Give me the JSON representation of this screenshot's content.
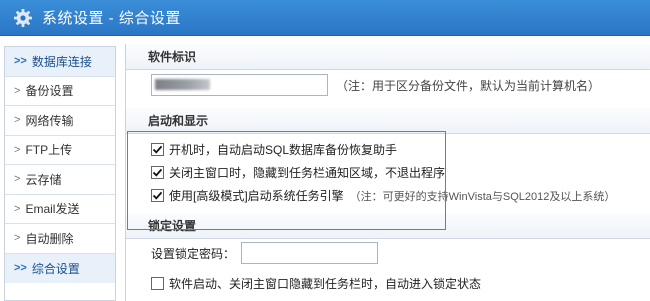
{
  "window": {
    "title": "系统设置 - 综合设置"
  },
  "sidebar": {
    "items": [
      {
        "label": "数据库连接",
        "marker": ">>",
        "active": true
      },
      {
        "label": "备份设置",
        "marker": ">",
        "active": false
      },
      {
        "label": "网络传输",
        "marker": ">",
        "active": false
      },
      {
        "label": "FTP上传",
        "marker": ">",
        "active": false
      },
      {
        "label": "云存储",
        "marker": ">",
        "active": false
      },
      {
        "label": "Email发送",
        "marker": ">",
        "active": false
      },
      {
        "label": "自动删除",
        "marker": ">",
        "active": false
      },
      {
        "label": "综合设置",
        "marker": ">>",
        "active": true
      }
    ]
  },
  "software_id": {
    "header": "软件标识",
    "hint": "（注：用于区分备份文件，默认为当前计算机名）"
  },
  "startup": {
    "header": "启动和显示",
    "option1": {
      "label": "开机时，自动启动SQL数据库备份恢复助手",
      "checked": true
    },
    "option2": {
      "label": "关闭主窗口时，隐藏到任务栏通知区域，不退出程序",
      "checked": true
    },
    "option3": {
      "label": "使用[高级模式]启动系统任务引擎",
      "checked": true,
      "note": "（注：可更好的支持WinVista与SQL2012及以上系统）"
    }
  },
  "lock": {
    "header": "锁定设置",
    "password_label": "设置锁定密码：",
    "password_value": "",
    "auto_lock": {
      "label": "软件启动、关闭主窗口隐藏到任务栏时，自动进入锁定状态",
      "checked": false
    }
  },
  "colors": {
    "titlebar": "#2a76c6",
    "highlight": "#d9534f",
    "active_nav": "#e8f0fa"
  }
}
